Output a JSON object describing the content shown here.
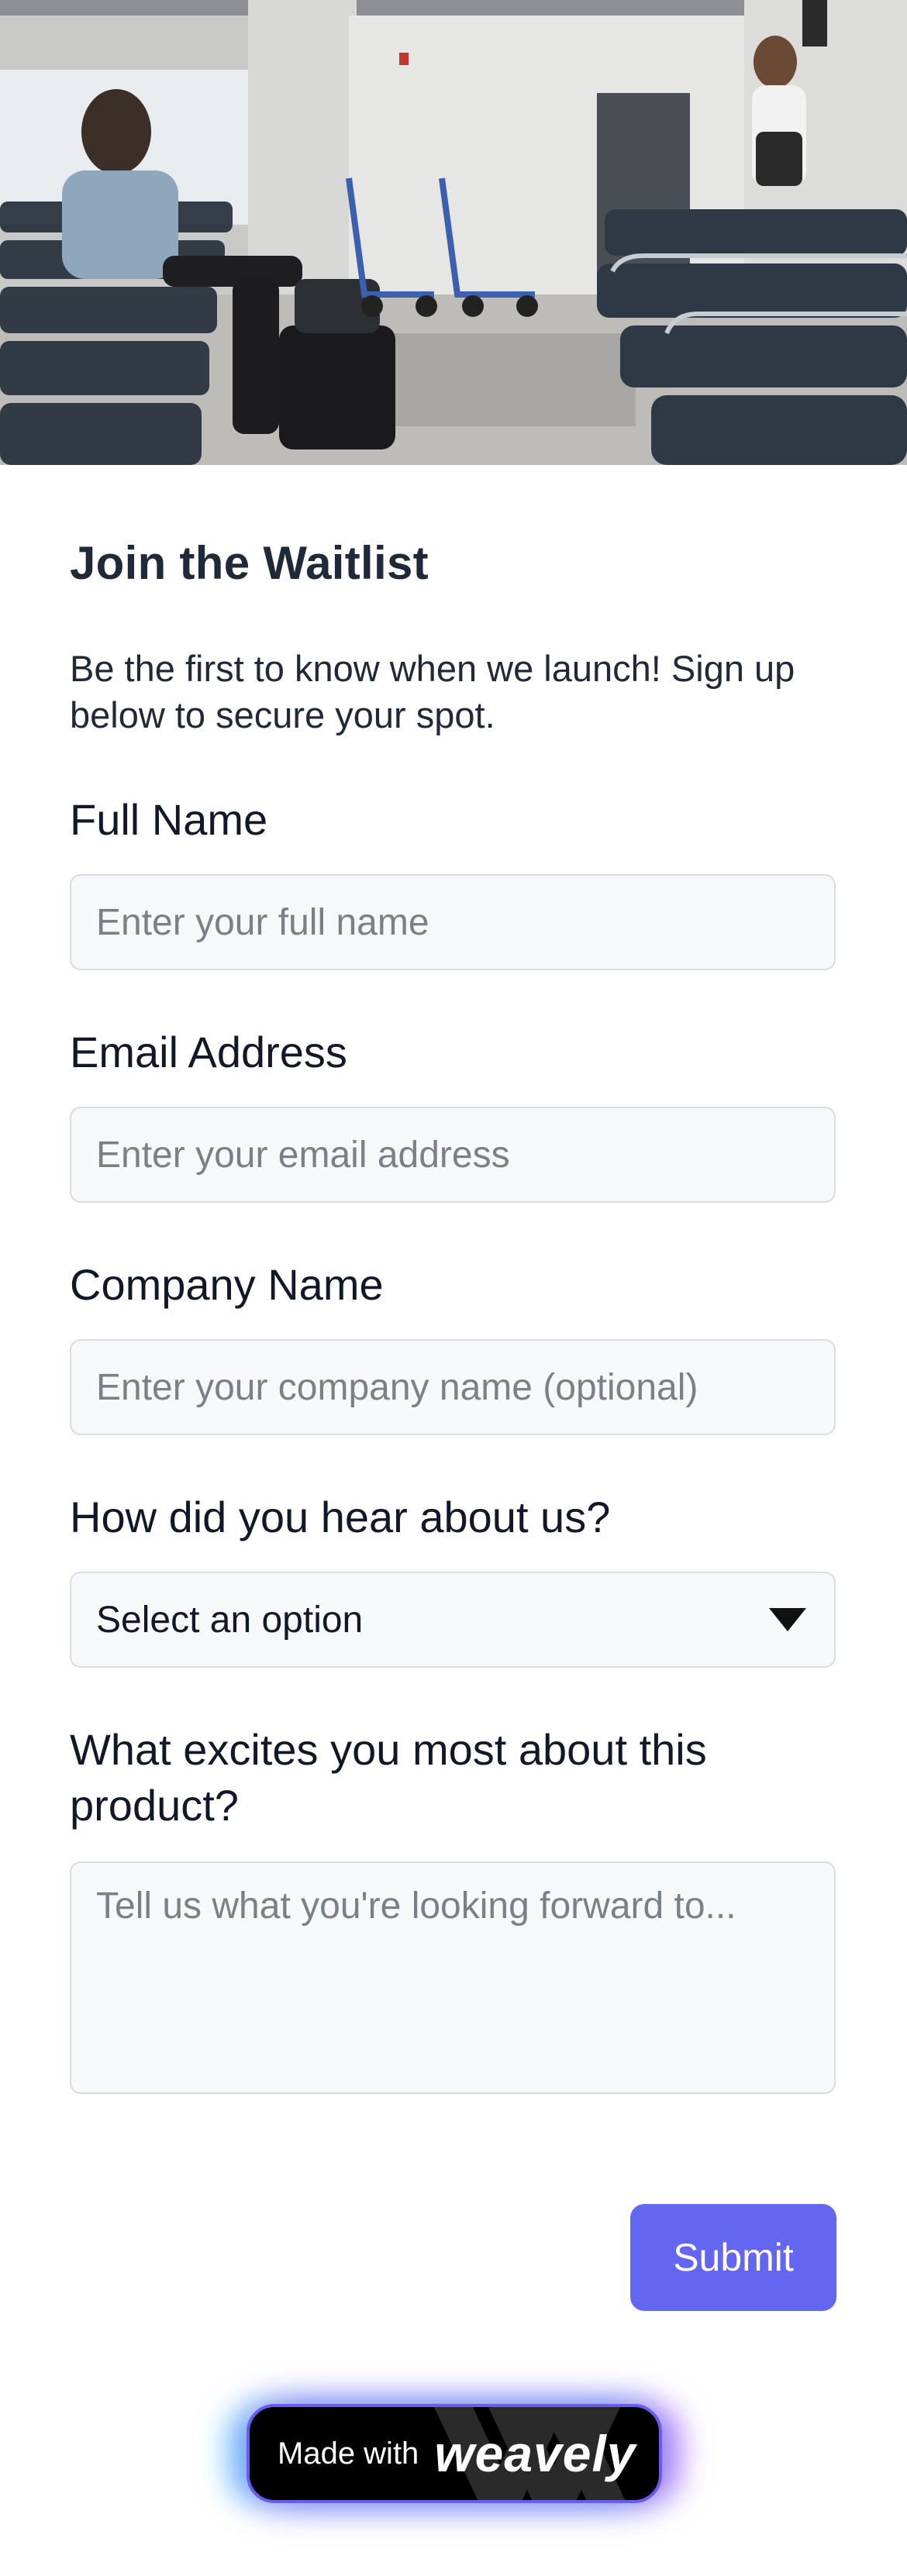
{
  "hero": {
    "image": "airport-waiting-area-photo"
  },
  "form": {
    "title": "Join the Waitlist",
    "subtitle": "Be the first to know when we launch! Sign up below to secure your spot.",
    "fields": {
      "full_name": {
        "label": "Full Name",
        "placeholder": "Enter your full name",
        "value": ""
      },
      "email": {
        "label": "Email Address",
        "placeholder": "Enter your email address",
        "value": ""
      },
      "company": {
        "label": "Company Name",
        "placeholder": "Enter your company name (optional)",
        "value": ""
      },
      "source": {
        "label": "How did you hear about us?",
        "selected": "Select an option",
        "icon": "caret-down-icon"
      },
      "excites": {
        "label": "What excites you most about this product?",
        "placeholder": "Tell us what you're looking forward to...",
        "value": ""
      }
    },
    "submit_label": "Submit"
  },
  "badge": {
    "prefix": "Made with",
    "brand": "weavely"
  },
  "colors": {
    "accent": "#6366f1",
    "input_bg": "#f7f8f9",
    "input_border": "#d9dce1",
    "badge_bg": "#000000"
  }
}
